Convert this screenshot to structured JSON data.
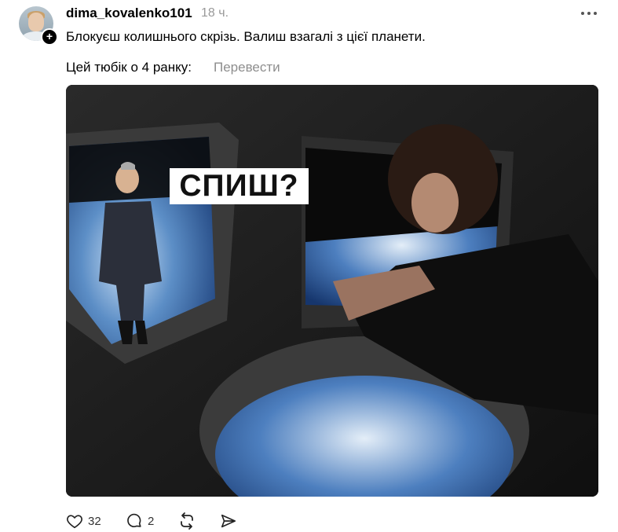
{
  "post": {
    "username": "dima_kovalenko101",
    "timestamp": "18 ч.",
    "text_line1": "Блокуєш колишнього скрізь. Валиш взагалі з цієї планети.",
    "text_line2": "Цей тюбік о 4 ранку:",
    "translate_label": "Перевести",
    "image_caption": "СПИШ?",
    "likes": "32",
    "comments": "2"
  },
  "icons": {
    "follow": "plus-icon",
    "more": "more-dots-icon",
    "like": "heart-icon",
    "comment": "comment-icon",
    "repost": "repost-icon",
    "share": "share-icon"
  }
}
